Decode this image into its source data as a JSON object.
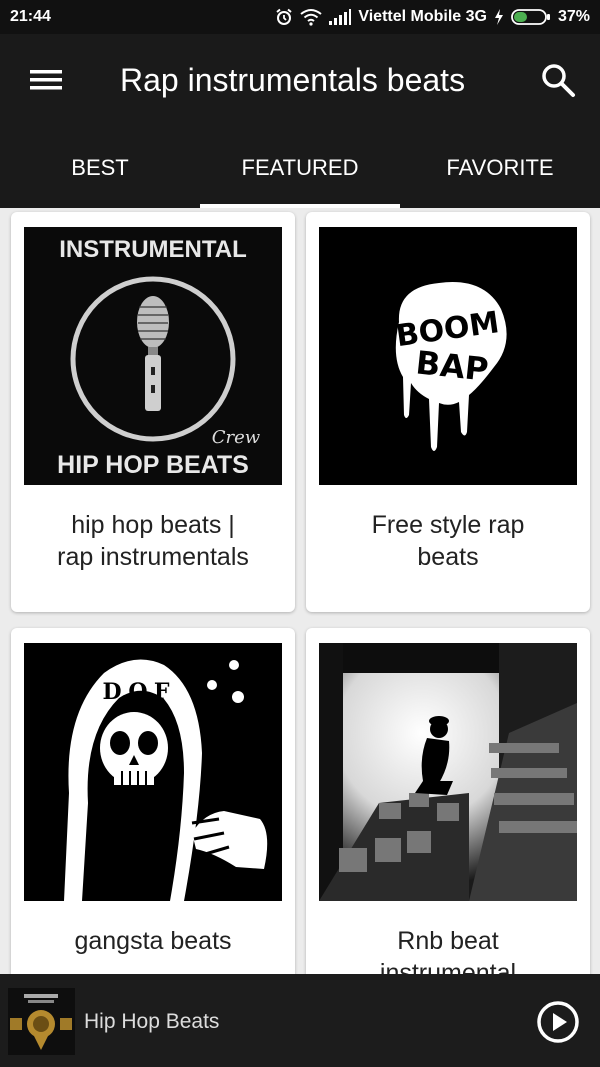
{
  "status_bar": {
    "time": "21:44",
    "carrier": "Viettel Mobile 3G",
    "battery": "37%",
    "icons": [
      "alarm-icon",
      "wifi-icon",
      "signal-icon",
      "charging-icon",
      "battery-icon"
    ]
  },
  "app_bar": {
    "title": "Rap instrumentals beats",
    "icons": [
      "menu-icon",
      "search-icon"
    ]
  },
  "tabs": [
    {
      "label": "BEST",
      "active": false
    },
    {
      "label": "FEATURED",
      "active": true
    },
    {
      "label": "FAVORITE",
      "active": false
    }
  ],
  "cards": [
    {
      "title_line1": "hip hop beats |",
      "title_line2": "rap instrumentals",
      "art": {
        "top_text": "INSTRUMENTAL",
        "script_text": "Crew",
        "bottom_text": "HIP HOP BEATS"
      }
    },
    {
      "title_line1": "Free style rap",
      "title_line2": "beats",
      "art": {
        "line1": "BOOM",
        "line2": "BAP"
      }
    },
    {
      "title_line1": "gangsta beats",
      "title_line2": "",
      "art": {
        "text": "D.O.F"
      }
    },
    {
      "title_line1": "Rnb beat",
      "title_line2": "instrumental",
      "art": {}
    }
  ],
  "player": {
    "track_title": "Hip Hop Beats",
    "icons": [
      "album-art-thumbnail",
      "play-icon"
    ]
  },
  "colors": {
    "app_bar": "#1a1a1a",
    "status_bar": "#111111",
    "background": "#ececec",
    "player": "#1c1c1c"
  }
}
